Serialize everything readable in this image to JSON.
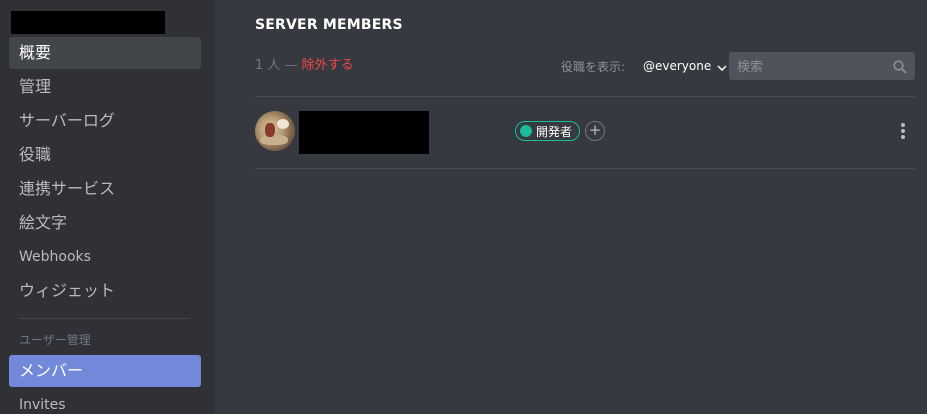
{
  "sidebar": {
    "items": [
      {
        "label": "概要"
      },
      {
        "label": "管理"
      },
      {
        "label": "サーバーログ"
      },
      {
        "label": "役職"
      },
      {
        "label": "連携サービス"
      },
      {
        "label": "絵文字"
      },
      {
        "label": "Webhooks"
      },
      {
        "label": "ウィジェット"
      }
    ],
    "section_header": "ユーザー管理",
    "user_items": [
      {
        "label": "メンバー"
      },
      {
        "label": "Invites"
      }
    ]
  },
  "main": {
    "title": "SERVER MEMBERS",
    "member_count": "1 人",
    "count_separator": " — ",
    "prune_label": "除外する",
    "role_filter_label": "役職を表示:",
    "role_filter_value": "@everyone",
    "search_placeholder": "検索",
    "members": [
      {
        "role": "開発者",
        "add_role": "+"
      }
    ]
  },
  "colors": {
    "accent": "#7289da",
    "danger": "#f04747",
    "role_developer": "#1abc9c"
  },
  "icons": [
    "search-icon",
    "chevron-down-icon",
    "plus-icon",
    "more-options-icon"
  ]
}
